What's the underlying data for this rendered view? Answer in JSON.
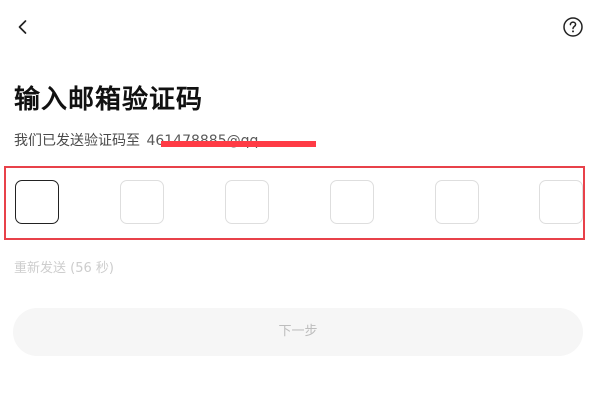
{
  "header": {
    "back_icon": "chevron-left-icon",
    "help_icon": "question-circle-icon"
  },
  "main": {
    "title": "输入邮箱验证码",
    "subtitle_prefix": "我们已发送验证码至",
    "email_partial": "461478885@qq"
  },
  "code_input": {
    "digits": [
      "",
      "",
      "",
      "",
      "",
      ""
    ],
    "active_index": 0
  },
  "resend": {
    "label": "重新发送 (56 秒)"
  },
  "actions": {
    "next_label": "下一步"
  },
  "colors": {
    "redaction": "#ff3b45",
    "highlight_border": "#e8414a",
    "disabled_text": "#bdbdbd",
    "button_bg": "#f6f6f6"
  }
}
